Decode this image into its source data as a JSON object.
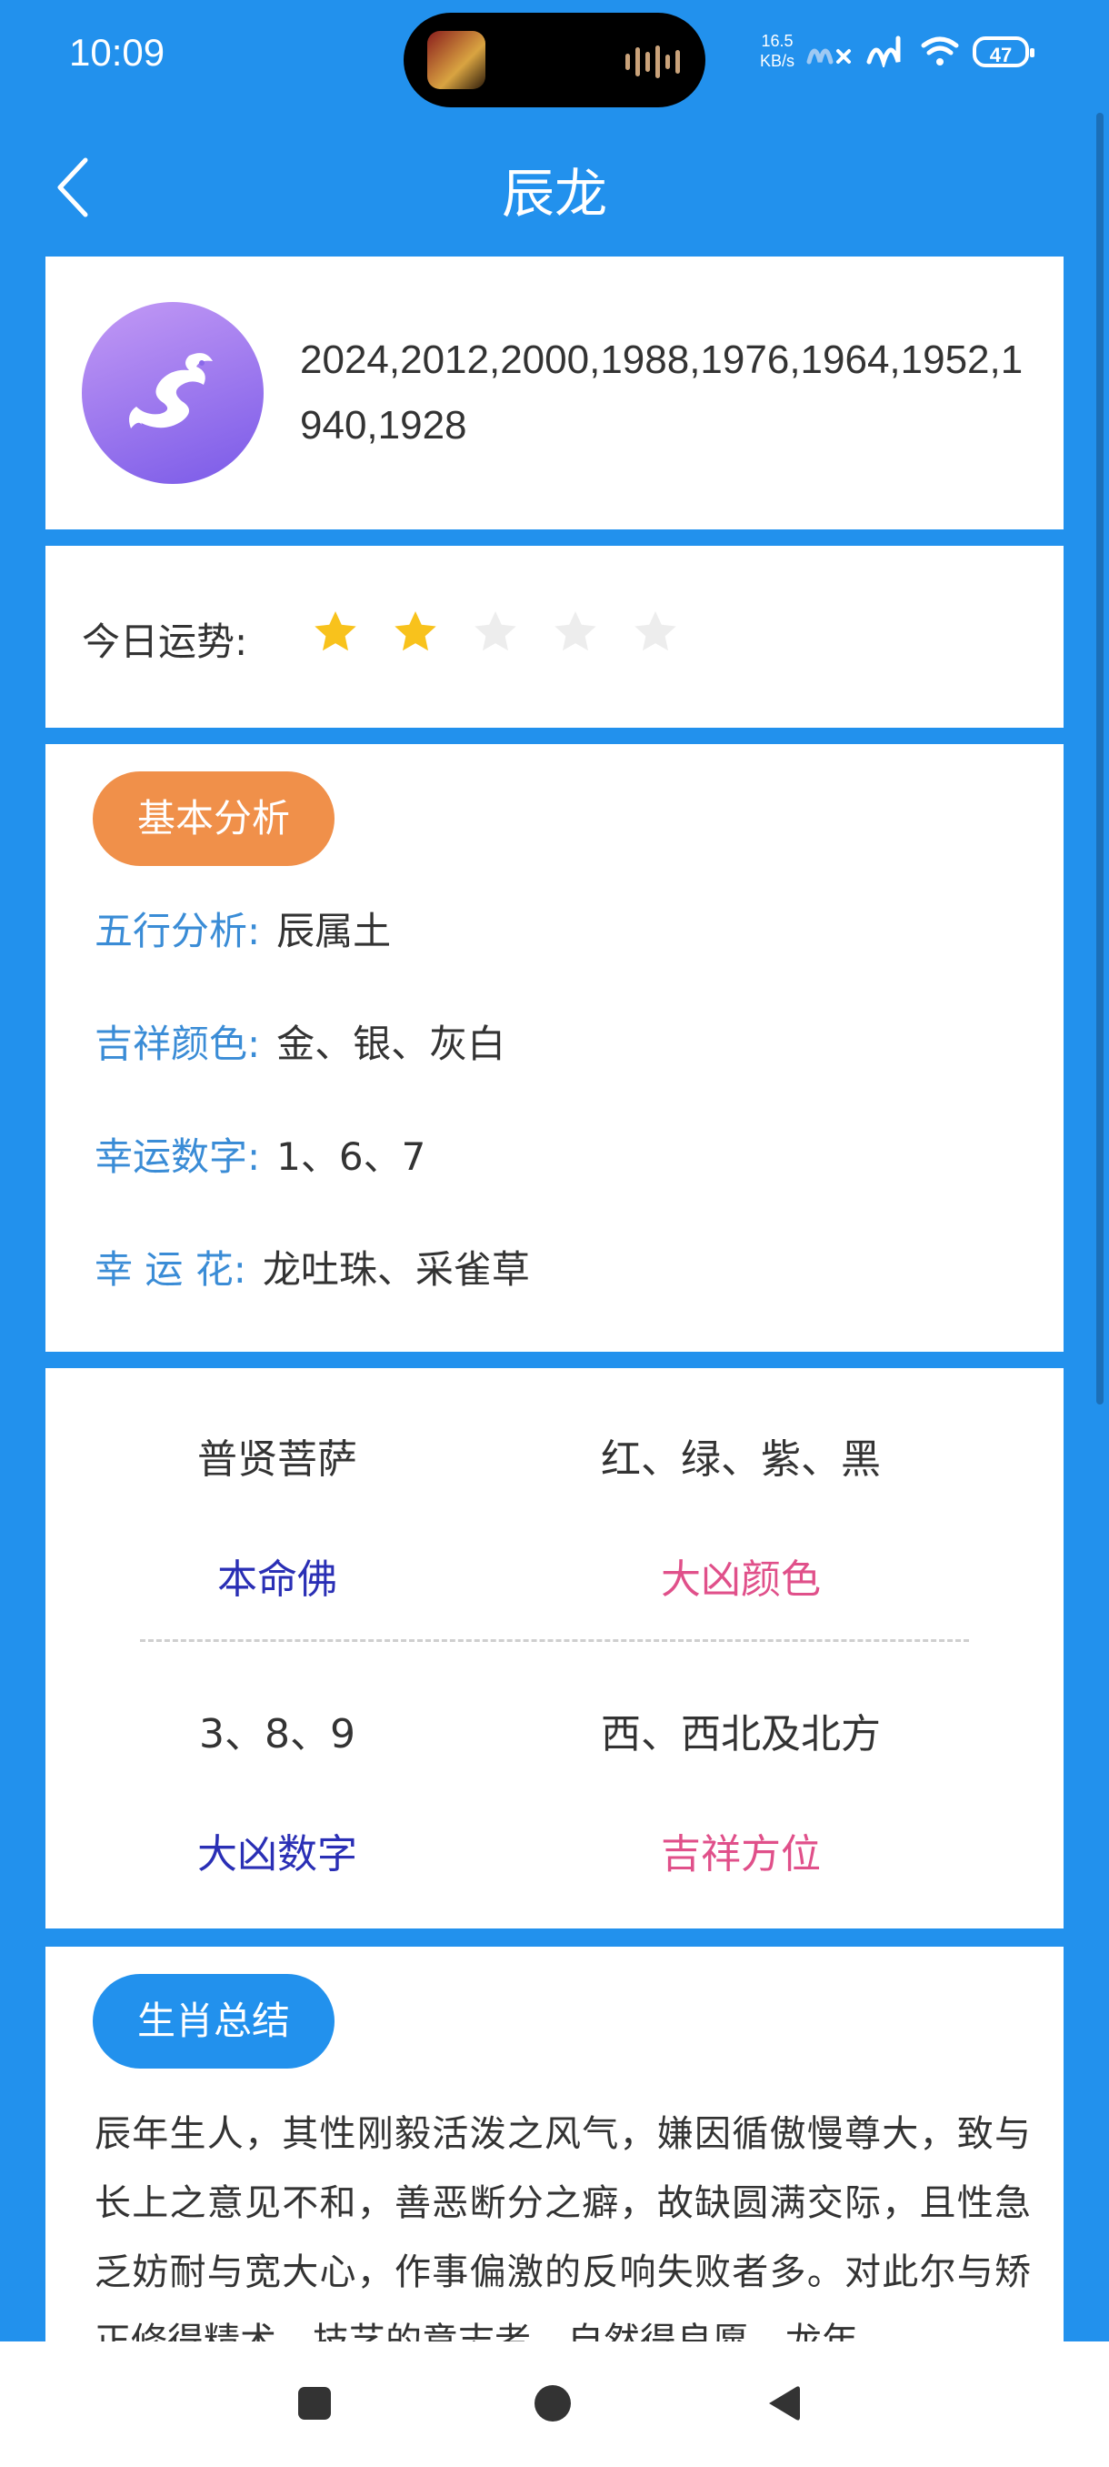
{
  "status_bar": {
    "time": "10:09",
    "net_speed_value": "16.5",
    "net_speed_unit": "KB/s",
    "battery": "47"
  },
  "header": {
    "title": "辰龙"
  },
  "zodiac": {
    "icon": "dragon-icon",
    "years": "2024,2012,2000,1988,1976,1964,1952,1940,1928"
  },
  "fortune": {
    "label": "今日运势:",
    "rating": 2,
    "max_rating": 5,
    "star_on_color": "#F8C21C",
    "star_off_color": "#EDEDED"
  },
  "basic_analysis": {
    "badge": "基本分析",
    "rows": [
      {
        "key": "五行分析:",
        "value": "辰属土"
      },
      {
        "key": "吉祥颜色:",
        "value": "金、银、灰白"
      },
      {
        "key": "幸运数字:",
        "value": "1、6、7"
      },
      {
        "key": "幸 运 花:",
        "value": "龙吐珠、采雀草"
      }
    ]
  },
  "grid": {
    "cells": [
      {
        "value": "普贤菩萨",
        "key": "本命佛",
        "key_color": "#2A2FB5"
      },
      {
        "value": "红、绿、紫、黑",
        "key": "大凶颜色",
        "key_color": "#E0508A"
      },
      {
        "value": "3、8、9",
        "key": "大凶数字",
        "key_color": "#2A2FB5"
      },
      {
        "value": "西、西北及北方",
        "key": "吉祥方位",
        "key_color": "#E0508A"
      }
    ]
  },
  "summary": {
    "badge": "生肖总结",
    "text": "辰年生人，其性刚毅活泼之风气，嫌因循傲慢尊大，致与长上之意见不和，善恶断分之癖，故缺圆满交际，且性急乏妨耐与宽大心，作事偏激的反响失败者多。对此尔与矫正修得精术，技艺的意志者，自然得良愿，龙年"
  },
  "colors": {
    "primary": "#2291ED",
    "orange": "#F0904A",
    "label_blue": "#3A8CD6"
  }
}
